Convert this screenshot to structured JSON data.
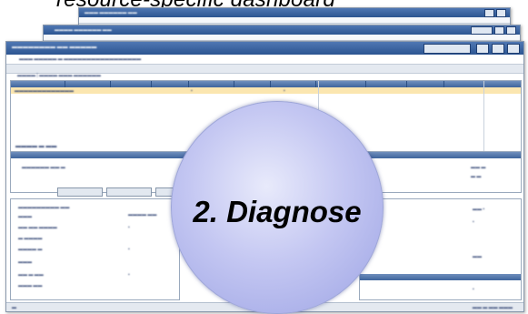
{
  "caption": "resource-specific dashboard",
  "overlay": {
    "label": "2. Diagnose",
    "color": "#b9bdf0"
  },
  "colors": {
    "title_bar": "#3a639f",
    "selected_row": "#fbe6b0",
    "window_bg": "#eef2f7"
  }
}
